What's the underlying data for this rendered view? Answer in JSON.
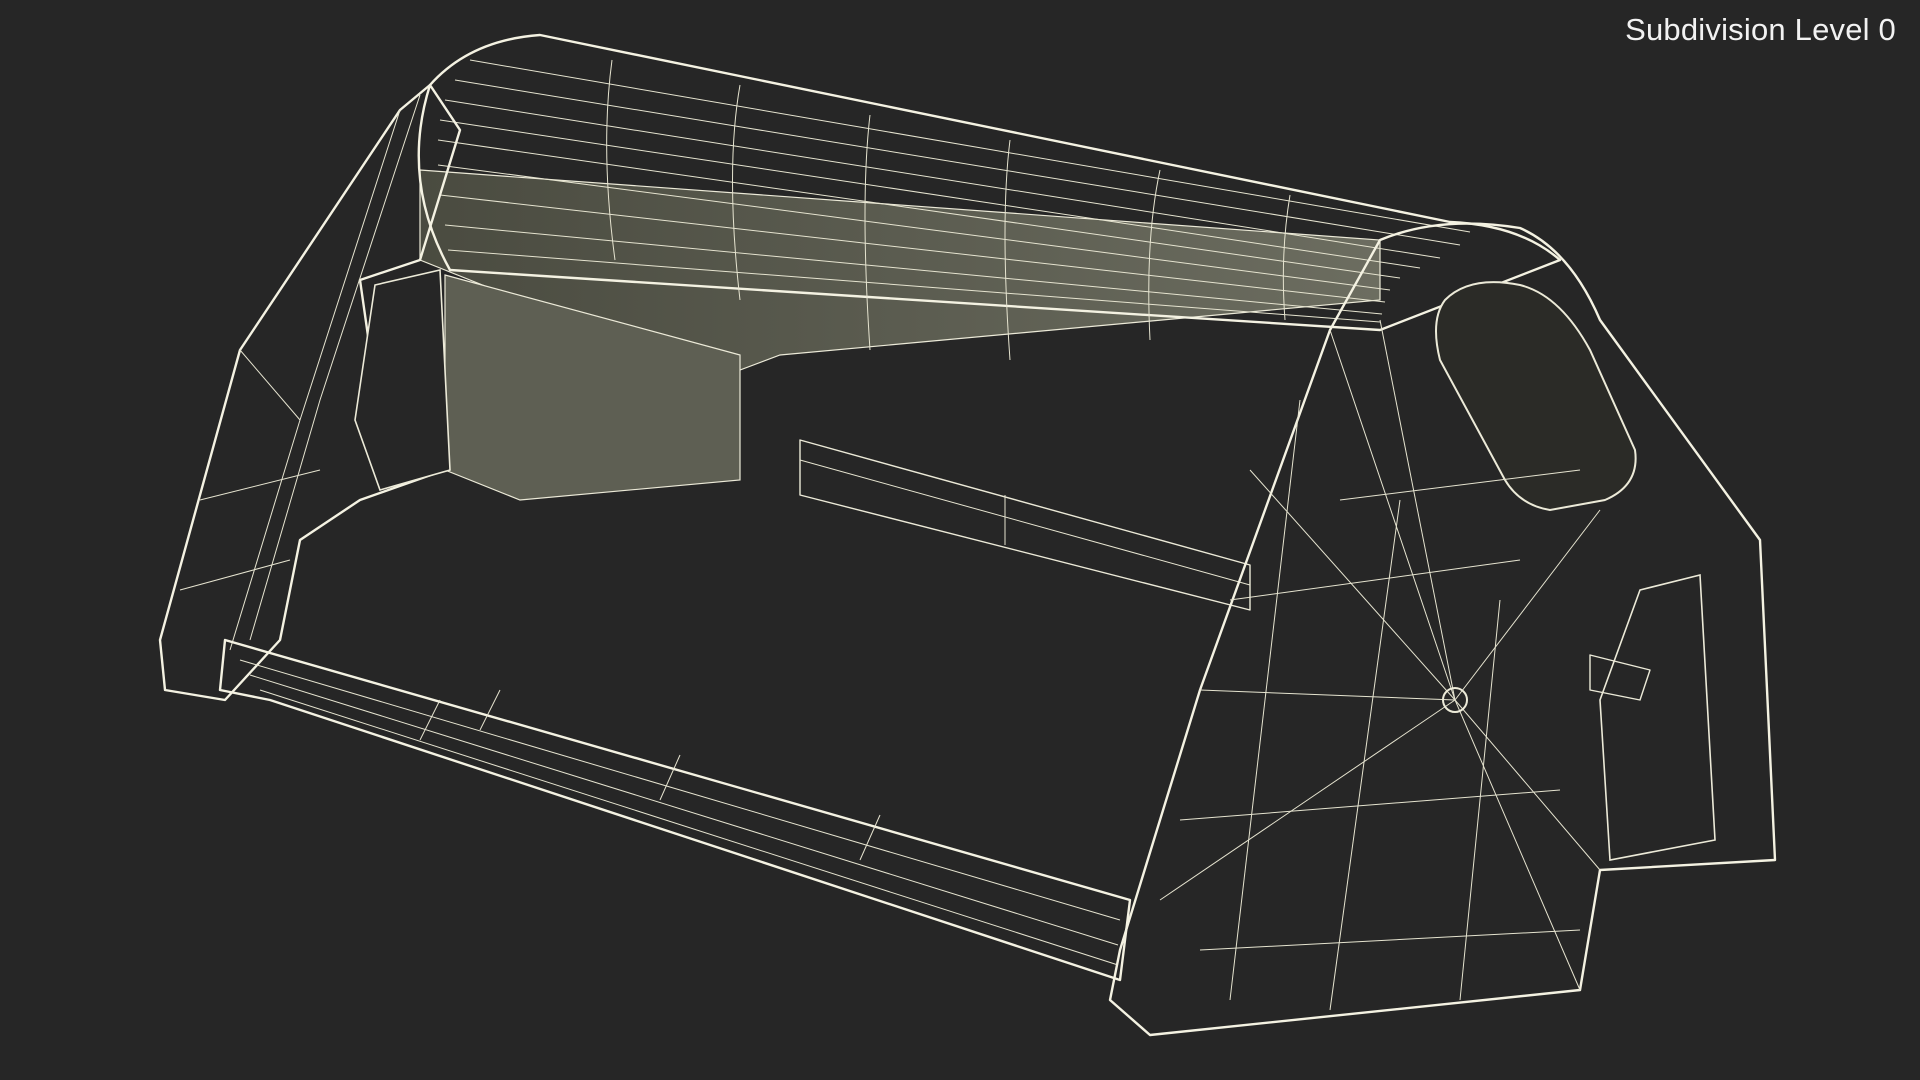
{
  "viewport": {
    "overlay_text": "Subdivision Level 0",
    "background_color": "#262626",
    "mesh_color": "#7d7e6f",
    "wire_color": "#ecead8"
  }
}
